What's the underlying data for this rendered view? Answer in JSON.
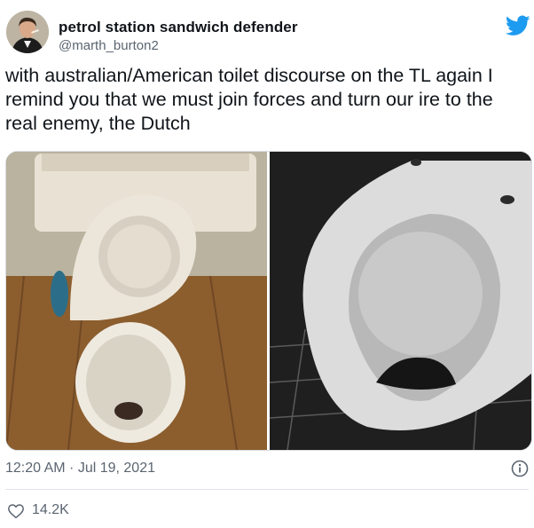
{
  "tweet": {
    "display_name": "petrol station sandwich defender",
    "handle": "@marth_burton2",
    "text": "with australian/American toilet discourse on the TL again I remind you that we must join forces and turn our ire to the real enemy, the Dutch",
    "timestamp": "12:20 AM · Jul 19, 2021",
    "likes": "14.2K"
  },
  "icons": {
    "avatar": "profile-photo",
    "brand": "twitter-bird-icon",
    "info": "info-icon",
    "like": "heart-icon"
  },
  "colors": {
    "twitter_blue": "#1d9bf0",
    "secondary_text": "#5b6570",
    "primary_text": "#0f1419"
  },
  "media": [
    {
      "kind": "photo",
      "subject": "toilet"
    },
    {
      "kind": "photo",
      "subject": "toilet"
    }
  ]
}
